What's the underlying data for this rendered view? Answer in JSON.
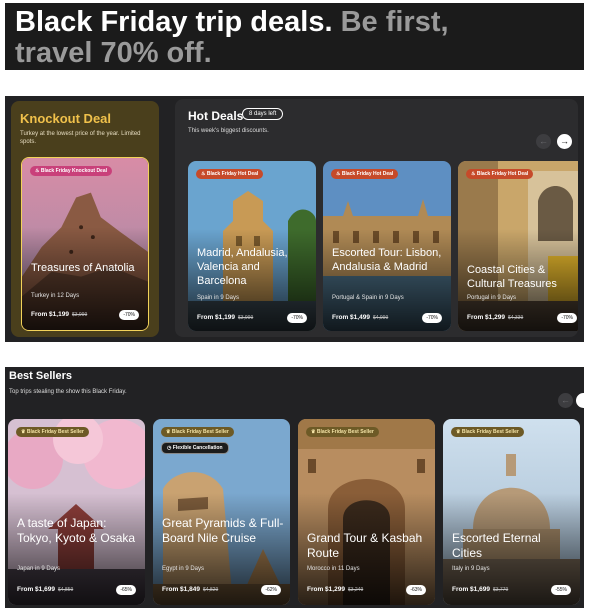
{
  "hero": {
    "line1_white": "Black Friday trip deals.",
    "line1_gray": " Be first,",
    "line2_gray": "travel 70% off."
  },
  "knockout": {
    "title": "Knockout Deal",
    "subtitle": "Turkey at the lowest price of the year. Limited spots.",
    "card": {
      "badge": "Black Friday Knockout Deal",
      "name": "Treasures of Anatolia",
      "location": "Turkey in 12 Days",
      "price": "From $1,199",
      "old_price": "$3,999",
      "discount": "-70%"
    }
  },
  "hot_deals": {
    "title": "Hot Deals",
    "days_left": "8 days left",
    "subtitle": "This week's biggest discounts.",
    "prev_icon": "arrow-left-icon",
    "next_icon": "arrow-right-icon",
    "cards": [
      {
        "badge": "Black Friday Hot Deal",
        "name": "Madrid, Andalusia, Valencia and Barcelona",
        "location": "Spain in 9 Days",
        "price": "From $1,199",
        "old_price": "$3,999",
        "discount": "-70%"
      },
      {
        "badge": "Black Friday Hot Deal",
        "name": "Escorted Tour: Lisbon, Andalusia & Madrid",
        "location": "Portugal & Spain in 9 Days",
        "price": "From $1,499",
        "old_price": "$4,999",
        "discount": "-70%"
      },
      {
        "badge": "Black Friday Hot Deal",
        "name": "Coastal Cities & Cultural Treasures",
        "location": "Portugal in 9 Days",
        "price": "From $1,299",
        "old_price": "$4,339",
        "discount": "-70%"
      }
    ]
  },
  "best_sellers": {
    "title": "Best Sellers",
    "subtitle": "Top trips stealing the show this Black Friday.",
    "cards": [
      {
        "badge": "Black Friday Best Seller",
        "name": "A taste of Japan: Tokyo, Kyoto & Osaka",
        "location": "Japan in 9 Days",
        "price": "From $1,699",
        "old_price": "$4,859",
        "discount": "-65%"
      },
      {
        "badge": "Black Friday Best Seller",
        "extra_badge": "Flexible Cancellation",
        "name": "Great Pyramids & Full-Board Nile Cruise",
        "location": "Egypt in 9 Days",
        "price": "From $1,849",
        "old_price": "$4,829",
        "discount": "-62%"
      },
      {
        "badge": "Black Friday Best Seller",
        "name": "Grand Tour & Kasbah Route",
        "location": "Morocco in 11 Days",
        "price": "From $1,299",
        "old_price": "$3,249",
        "discount": "-63%"
      },
      {
        "badge": "Black Friday Best Seller",
        "name": "Escorted Eternal Cities",
        "location": "Italy in 9 Days",
        "price": "From $1,699",
        "old_price": "$3,779",
        "discount": "-55%"
      }
    ]
  }
}
